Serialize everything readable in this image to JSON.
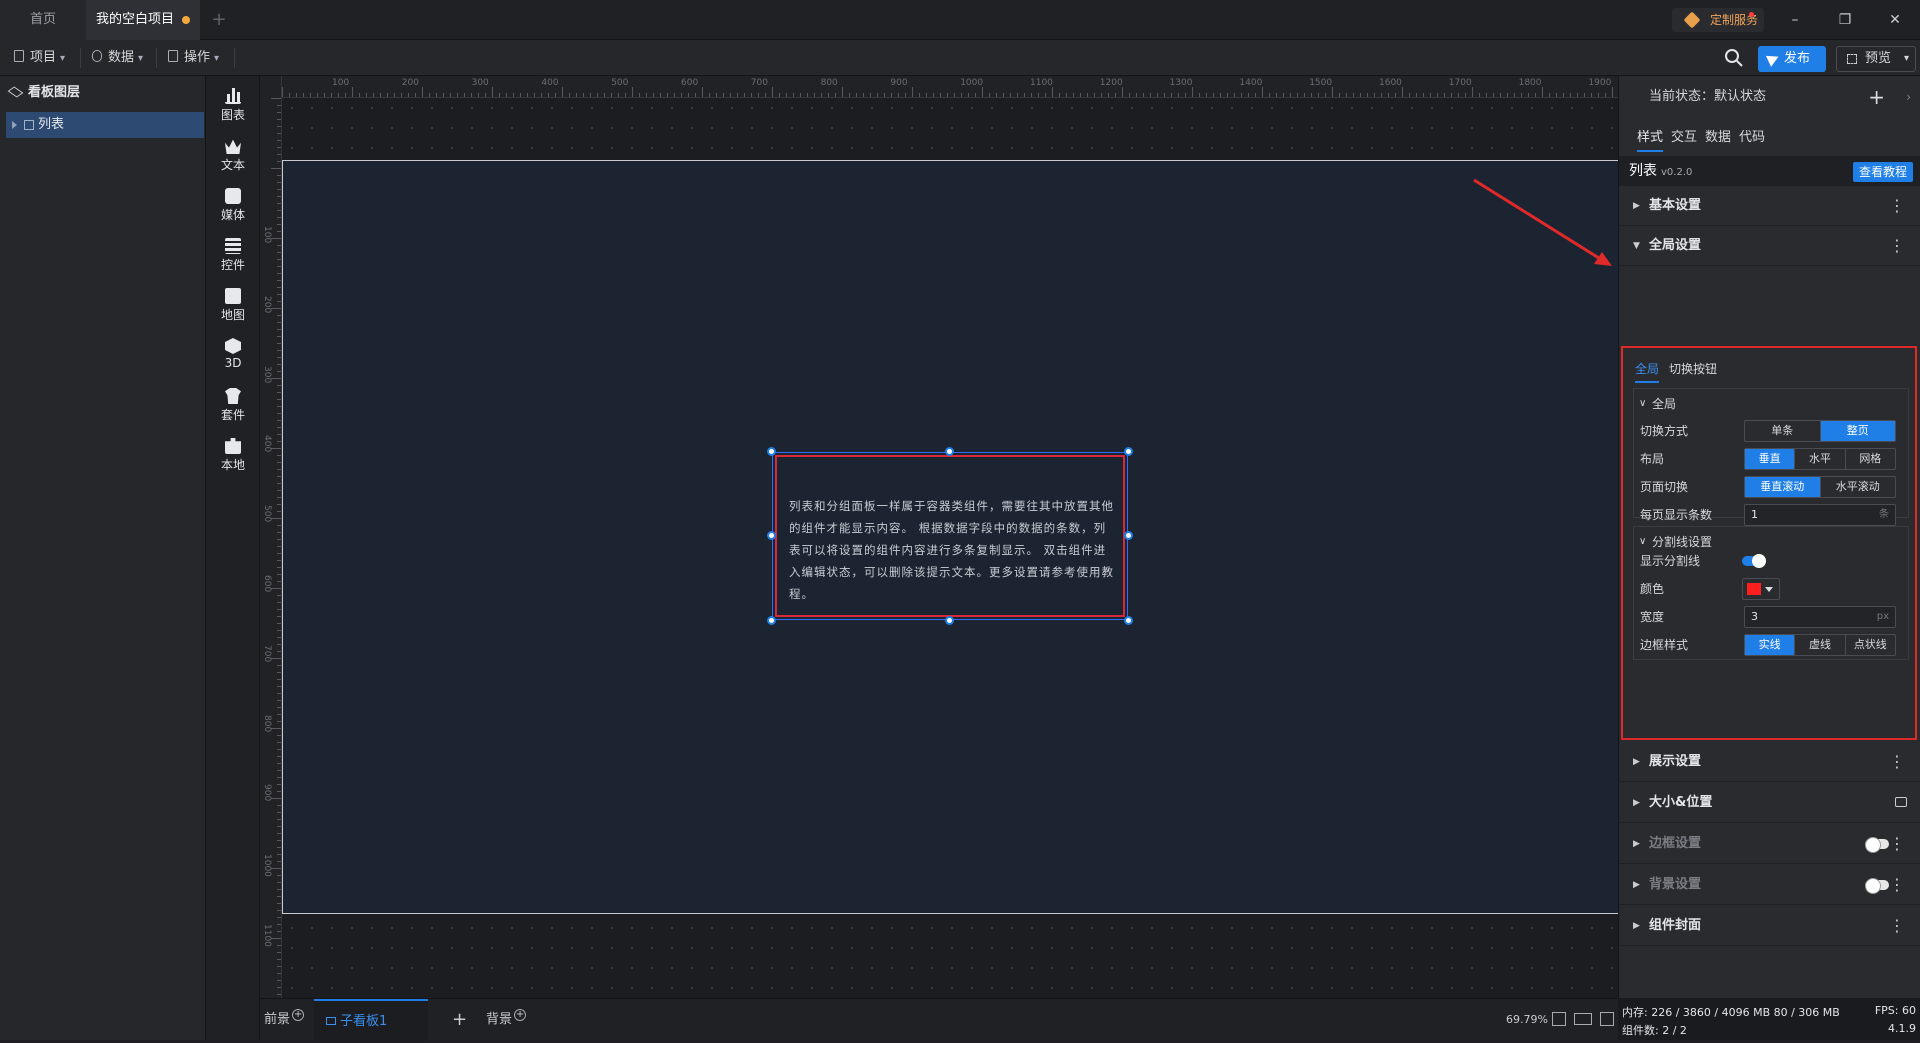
{
  "titlebar": {
    "tabs": [
      {
        "label": "首页"
      },
      {
        "label": "我的空白项目"
      }
    ],
    "custom_service": "定制服务"
  },
  "menubar": {
    "project": "项目",
    "data": "数据",
    "operate": "操作",
    "publish": "发布",
    "preview": "预览"
  },
  "layers": {
    "title": "看板图层",
    "items": [
      {
        "label": "列表"
      }
    ]
  },
  "tools": [
    {
      "label": "图表",
      "icon": "chart-icon"
    },
    {
      "label": "文本",
      "icon": "text-icon"
    },
    {
      "label": "媒体",
      "icon": "media-icon"
    },
    {
      "label": "控件",
      "icon": "widget-icon"
    },
    {
      "label": "地图",
      "icon": "map-icon"
    },
    {
      "label": "3D",
      "icon": "cube-icon"
    },
    {
      "label": "套件",
      "icon": "kit-icon"
    },
    {
      "label": "本地",
      "icon": "puzzle-icon"
    }
  ],
  "ruler": {
    "top": [
      "100",
      "200",
      "300",
      "400",
      "500",
      "600",
      "700",
      "800",
      "900",
      "1000",
      "1100",
      "1200",
      "1300",
      "1400",
      "1500",
      "1600",
      "1700",
      "1800",
      "1900"
    ],
    "left": [
      "100",
      "200",
      "300",
      "400",
      "500",
      "600",
      "700",
      "800",
      "900",
      "1000",
      "1100"
    ]
  },
  "canvas": {
    "list_text": "列表和分组面板一样属于容器类组件，需要往其中放置其他的组件才能显示内容。 根据数据字段中的数据的条数，列表可以将设置的组件内容进行多条复制显示。 双击组件进入编辑状态，可以删除该提示文本。更多设置请参考使用教程。"
  },
  "bottombar": {
    "foreground": "前景",
    "child_board": "子看板1",
    "background": "背景",
    "zoom": "69.79%"
  },
  "rpanel": {
    "state": "当前状态：默认状态",
    "tabs": [
      "样式",
      "交互",
      "数据",
      "代码"
    ],
    "component_name": "列表",
    "component_version": "v0.2.0",
    "tutorial": "查看教程",
    "sections": {
      "basic": "基本设置",
      "global": "全局设置",
      "display": "展示设置",
      "size_pos": "大小&位置",
      "border": "边框设置",
      "bg": "背景设置",
      "cover": "组件封面"
    },
    "subtabs": [
      "全局",
      "切换按钮"
    ],
    "group_global": {
      "title": "全局",
      "switch_mode": {
        "label": "切换方式",
        "options": [
          "单条",
          "整页"
        ],
        "selected": "整页"
      },
      "layout": {
        "label": "布局",
        "options": [
          "垂直",
          "水平",
          "网格"
        ],
        "selected": "垂直"
      },
      "page_switch": {
        "label": "页面切换",
        "options": [
          "垂直滚动",
          "水平滚动"
        ],
        "selected": "垂直滚动"
      },
      "per_page": {
        "label": "每页显示条数",
        "value": "1",
        "unit": "条"
      }
    },
    "group_divider": {
      "title": "分割线设置",
      "show": {
        "label": "显示分割线",
        "on": true
      },
      "color": {
        "label": "颜色",
        "value": "#ff1e1e"
      },
      "width": {
        "label": "宽度",
        "value": "3",
        "unit": "px"
      },
      "style": {
        "label": "边框样式",
        "options": [
          "实线",
          "虚线",
          "点状线"
        ],
        "selected": "实线"
      }
    }
  },
  "status": {
    "memory": "内存:  226 / 3860 / 4096 MB  80 / 306 MB",
    "fps": "FPS:  60",
    "components": "组件数: 2 / 2",
    "version": "4.1.9"
  },
  "colors": {
    "accent": "#1f7fe6",
    "annotation": "#e02a2a"
  }
}
